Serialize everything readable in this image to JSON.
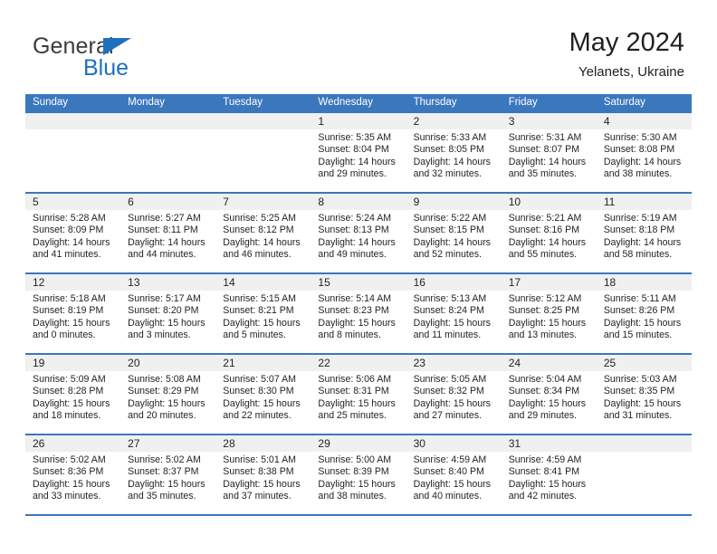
{
  "brand": {
    "name_part1": "General",
    "name_part2": "Blue",
    "triangle_color": "#1f70c1",
    "text_color": "#3c3c3b"
  },
  "header": {
    "title": "May 2024",
    "subtitle": "Yelanets, Ukraine",
    "accent_color": "#3b77bd"
  },
  "calendar": {
    "day_headers": [
      "Sunday",
      "Monday",
      "Tuesday",
      "Wednesday",
      "Thursday",
      "Friday",
      "Saturday"
    ],
    "weeks": [
      [
        {
          "day": "",
          "empty": true
        },
        {
          "day": "",
          "empty": true
        },
        {
          "day": "",
          "empty": true
        },
        {
          "day": "1",
          "sunrise": "Sunrise: 5:35 AM",
          "sunset": "Sunset: 8:04 PM",
          "daylight_1": "Daylight: 14 hours",
          "daylight_2": "and 29 minutes."
        },
        {
          "day": "2",
          "sunrise": "Sunrise: 5:33 AM",
          "sunset": "Sunset: 8:05 PM",
          "daylight_1": "Daylight: 14 hours",
          "daylight_2": "and 32 minutes."
        },
        {
          "day": "3",
          "sunrise": "Sunrise: 5:31 AM",
          "sunset": "Sunset: 8:07 PM",
          "daylight_1": "Daylight: 14 hours",
          "daylight_2": "and 35 minutes."
        },
        {
          "day": "4",
          "sunrise": "Sunrise: 5:30 AM",
          "sunset": "Sunset: 8:08 PM",
          "daylight_1": "Daylight: 14 hours",
          "daylight_2": "and 38 minutes."
        }
      ],
      [
        {
          "day": "5",
          "sunrise": "Sunrise: 5:28 AM",
          "sunset": "Sunset: 8:09 PM",
          "daylight_1": "Daylight: 14 hours",
          "daylight_2": "and 41 minutes."
        },
        {
          "day": "6",
          "sunrise": "Sunrise: 5:27 AM",
          "sunset": "Sunset: 8:11 PM",
          "daylight_1": "Daylight: 14 hours",
          "daylight_2": "and 44 minutes."
        },
        {
          "day": "7",
          "sunrise": "Sunrise: 5:25 AM",
          "sunset": "Sunset: 8:12 PM",
          "daylight_1": "Daylight: 14 hours",
          "daylight_2": "and 46 minutes."
        },
        {
          "day": "8",
          "sunrise": "Sunrise: 5:24 AM",
          "sunset": "Sunset: 8:13 PM",
          "daylight_1": "Daylight: 14 hours",
          "daylight_2": "and 49 minutes."
        },
        {
          "day": "9",
          "sunrise": "Sunrise: 5:22 AM",
          "sunset": "Sunset: 8:15 PM",
          "daylight_1": "Daylight: 14 hours",
          "daylight_2": "and 52 minutes."
        },
        {
          "day": "10",
          "sunrise": "Sunrise: 5:21 AM",
          "sunset": "Sunset: 8:16 PM",
          "daylight_1": "Daylight: 14 hours",
          "daylight_2": "and 55 minutes."
        },
        {
          "day": "11",
          "sunrise": "Sunrise: 5:19 AM",
          "sunset": "Sunset: 8:18 PM",
          "daylight_1": "Daylight: 14 hours",
          "daylight_2": "and 58 minutes."
        }
      ],
      [
        {
          "day": "12",
          "sunrise": "Sunrise: 5:18 AM",
          "sunset": "Sunset: 8:19 PM",
          "daylight_1": "Daylight: 15 hours",
          "daylight_2": "and 0 minutes."
        },
        {
          "day": "13",
          "sunrise": "Sunrise: 5:17 AM",
          "sunset": "Sunset: 8:20 PM",
          "daylight_1": "Daylight: 15 hours",
          "daylight_2": "and 3 minutes."
        },
        {
          "day": "14",
          "sunrise": "Sunrise: 5:15 AM",
          "sunset": "Sunset: 8:21 PM",
          "daylight_1": "Daylight: 15 hours",
          "daylight_2": "and 5 minutes."
        },
        {
          "day": "15",
          "sunrise": "Sunrise: 5:14 AM",
          "sunset": "Sunset: 8:23 PM",
          "daylight_1": "Daylight: 15 hours",
          "daylight_2": "and 8 minutes."
        },
        {
          "day": "16",
          "sunrise": "Sunrise: 5:13 AM",
          "sunset": "Sunset: 8:24 PM",
          "daylight_1": "Daylight: 15 hours",
          "daylight_2": "and 11 minutes."
        },
        {
          "day": "17",
          "sunrise": "Sunrise: 5:12 AM",
          "sunset": "Sunset: 8:25 PM",
          "daylight_1": "Daylight: 15 hours",
          "daylight_2": "and 13 minutes."
        },
        {
          "day": "18",
          "sunrise": "Sunrise: 5:11 AM",
          "sunset": "Sunset: 8:26 PM",
          "daylight_1": "Daylight: 15 hours",
          "daylight_2": "and 15 minutes."
        }
      ],
      [
        {
          "day": "19",
          "sunrise": "Sunrise: 5:09 AM",
          "sunset": "Sunset: 8:28 PM",
          "daylight_1": "Daylight: 15 hours",
          "daylight_2": "and 18 minutes."
        },
        {
          "day": "20",
          "sunrise": "Sunrise: 5:08 AM",
          "sunset": "Sunset: 8:29 PM",
          "daylight_1": "Daylight: 15 hours",
          "daylight_2": "and 20 minutes."
        },
        {
          "day": "21",
          "sunrise": "Sunrise: 5:07 AM",
          "sunset": "Sunset: 8:30 PM",
          "daylight_1": "Daylight: 15 hours",
          "daylight_2": "and 22 minutes."
        },
        {
          "day": "22",
          "sunrise": "Sunrise: 5:06 AM",
          "sunset": "Sunset: 8:31 PM",
          "daylight_1": "Daylight: 15 hours",
          "daylight_2": "and 25 minutes."
        },
        {
          "day": "23",
          "sunrise": "Sunrise: 5:05 AM",
          "sunset": "Sunset: 8:32 PM",
          "daylight_1": "Daylight: 15 hours",
          "daylight_2": "and 27 minutes."
        },
        {
          "day": "24",
          "sunrise": "Sunrise: 5:04 AM",
          "sunset": "Sunset: 8:34 PM",
          "daylight_1": "Daylight: 15 hours",
          "daylight_2": "and 29 minutes."
        },
        {
          "day": "25",
          "sunrise": "Sunrise: 5:03 AM",
          "sunset": "Sunset: 8:35 PM",
          "daylight_1": "Daylight: 15 hours",
          "daylight_2": "and 31 minutes."
        }
      ],
      [
        {
          "day": "26",
          "sunrise": "Sunrise: 5:02 AM",
          "sunset": "Sunset: 8:36 PM",
          "daylight_1": "Daylight: 15 hours",
          "daylight_2": "and 33 minutes."
        },
        {
          "day": "27",
          "sunrise": "Sunrise: 5:02 AM",
          "sunset": "Sunset: 8:37 PM",
          "daylight_1": "Daylight: 15 hours",
          "daylight_2": "and 35 minutes."
        },
        {
          "day": "28",
          "sunrise": "Sunrise: 5:01 AM",
          "sunset": "Sunset: 8:38 PM",
          "daylight_1": "Daylight: 15 hours",
          "daylight_2": "and 37 minutes."
        },
        {
          "day": "29",
          "sunrise": "Sunrise: 5:00 AM",
          "sunset": "Sunset: 8:39 PM",
          "daylight_1": "Daylight: 15 hours",
          "daylight_2": "and 38 minutes."
        },
        {
          "day": "30",
          "sunrise": "Sunrise: 4:59 AM",
          "sunset": "Sunset: 8:40 PM",
          "daylight_1": "Daylight: 15 hours",
          "daylight_2": "and 40 minutes."
        },
        {
          "day": "31",
          "sunrise": "Sunrise: 4:59 AM",
          "sunset": "Sunset: 8:41 PM",
          "daylight_1": "Daylight: 15 hours",
          "daylight_2": "and 42 minutes."
        },
        {
          "day": "",
          "empty": true
        }
      ]
    ]
  }
}
